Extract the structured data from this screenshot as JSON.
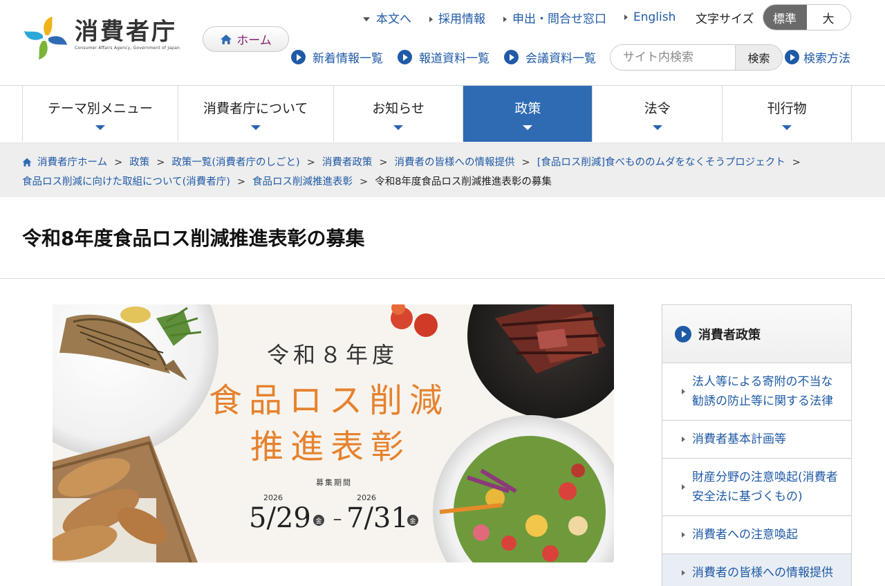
{
  "header": {
    "logo_name": "消費者庁",
    "logo_sub": "Consumer Affairs Agency, Government of Japan",
    "home_label": "ホーム",
    "top_links": [
      {
        "label": "本文へ",
        "marker": "down"
      },
      {
        "label": "採用情報",
        "marker": "right"
      },
      {
        "label": "申出・問合せ窓口",
        "marker": "right"
      },
      {
        "label": "English",
        "marker": "right"
      }
    ],
    "font_size_label": "文字サイズ",
    "font_size_options": [
      "標準",
      "大"
    ],
    "font_size_selected": "標準",
    "sub_links": [
      "新着情報一覧",
      "報道資料一覧",
      "会議資料一覧"
    ],
    "search_placeholder": "サイト内検索",
    "search_button": "検索",
    "search_help": "検索方法"
  },
  "nav": {
    "items": [
      "テーマ別メニュー",
      "消費者庁について",
      "お知らせ",
      "政策",
      "法令",
      "刊行物"
    ],
    "active": "政策"
  },
  "breadcrumb": {
    "links": [
      "消費者庁ホーム",
      "政策",
      "政策一覧(消費者庁のしごと)",
      "消費者政策",
      "消費者の皆様への情報提供",
      "[食品ロス削減]食べもののムダをなくそうプロジェクト",
      "食品ロス削減に向けた取組について(消費者庁)",
      "食品ロス削減推進表彰"
    ],
    "separator": ">",
    "current": "令和8年度食品ロス削減推進表彰の募集"
  },
  "page_title": "令和8年度食品ロス削減推進表彰の募集",
  "banner": {
    "year_line": "令和８年度",
    "main_line1": "食品ロス削減",
    "main_line2": "推進表彰",
    "period_label": "募集期間",
    "start_year": "2026",
    "start_date": "5/29",
    "start_weekday": "金",
    "dash": "–",
    "end_year": "2026",
    "end_date": "7/31",
    "end_weekday": "金",
    "accent_color": "#e5822e"
  },
  "side_menu": {
    "title": "消費者政策",
    "items": [
      "法人等による寄附の不当な勧誘の防止等に関する法律",
      "消費者基本計画等",
      "財産分野の注意喚起(消費者安全法に基づくもの)",
      "消費者への注意喚起",
      "消費者の皆様への情報提供"
    ]
  },
  "colors": {
    "link": "#1f5aa6",
    "nav_active": "#2f6bb3",
    "home_text": "#8a1f74",
    "breadcrumb_bg": "#eeeeee"
  }
}
